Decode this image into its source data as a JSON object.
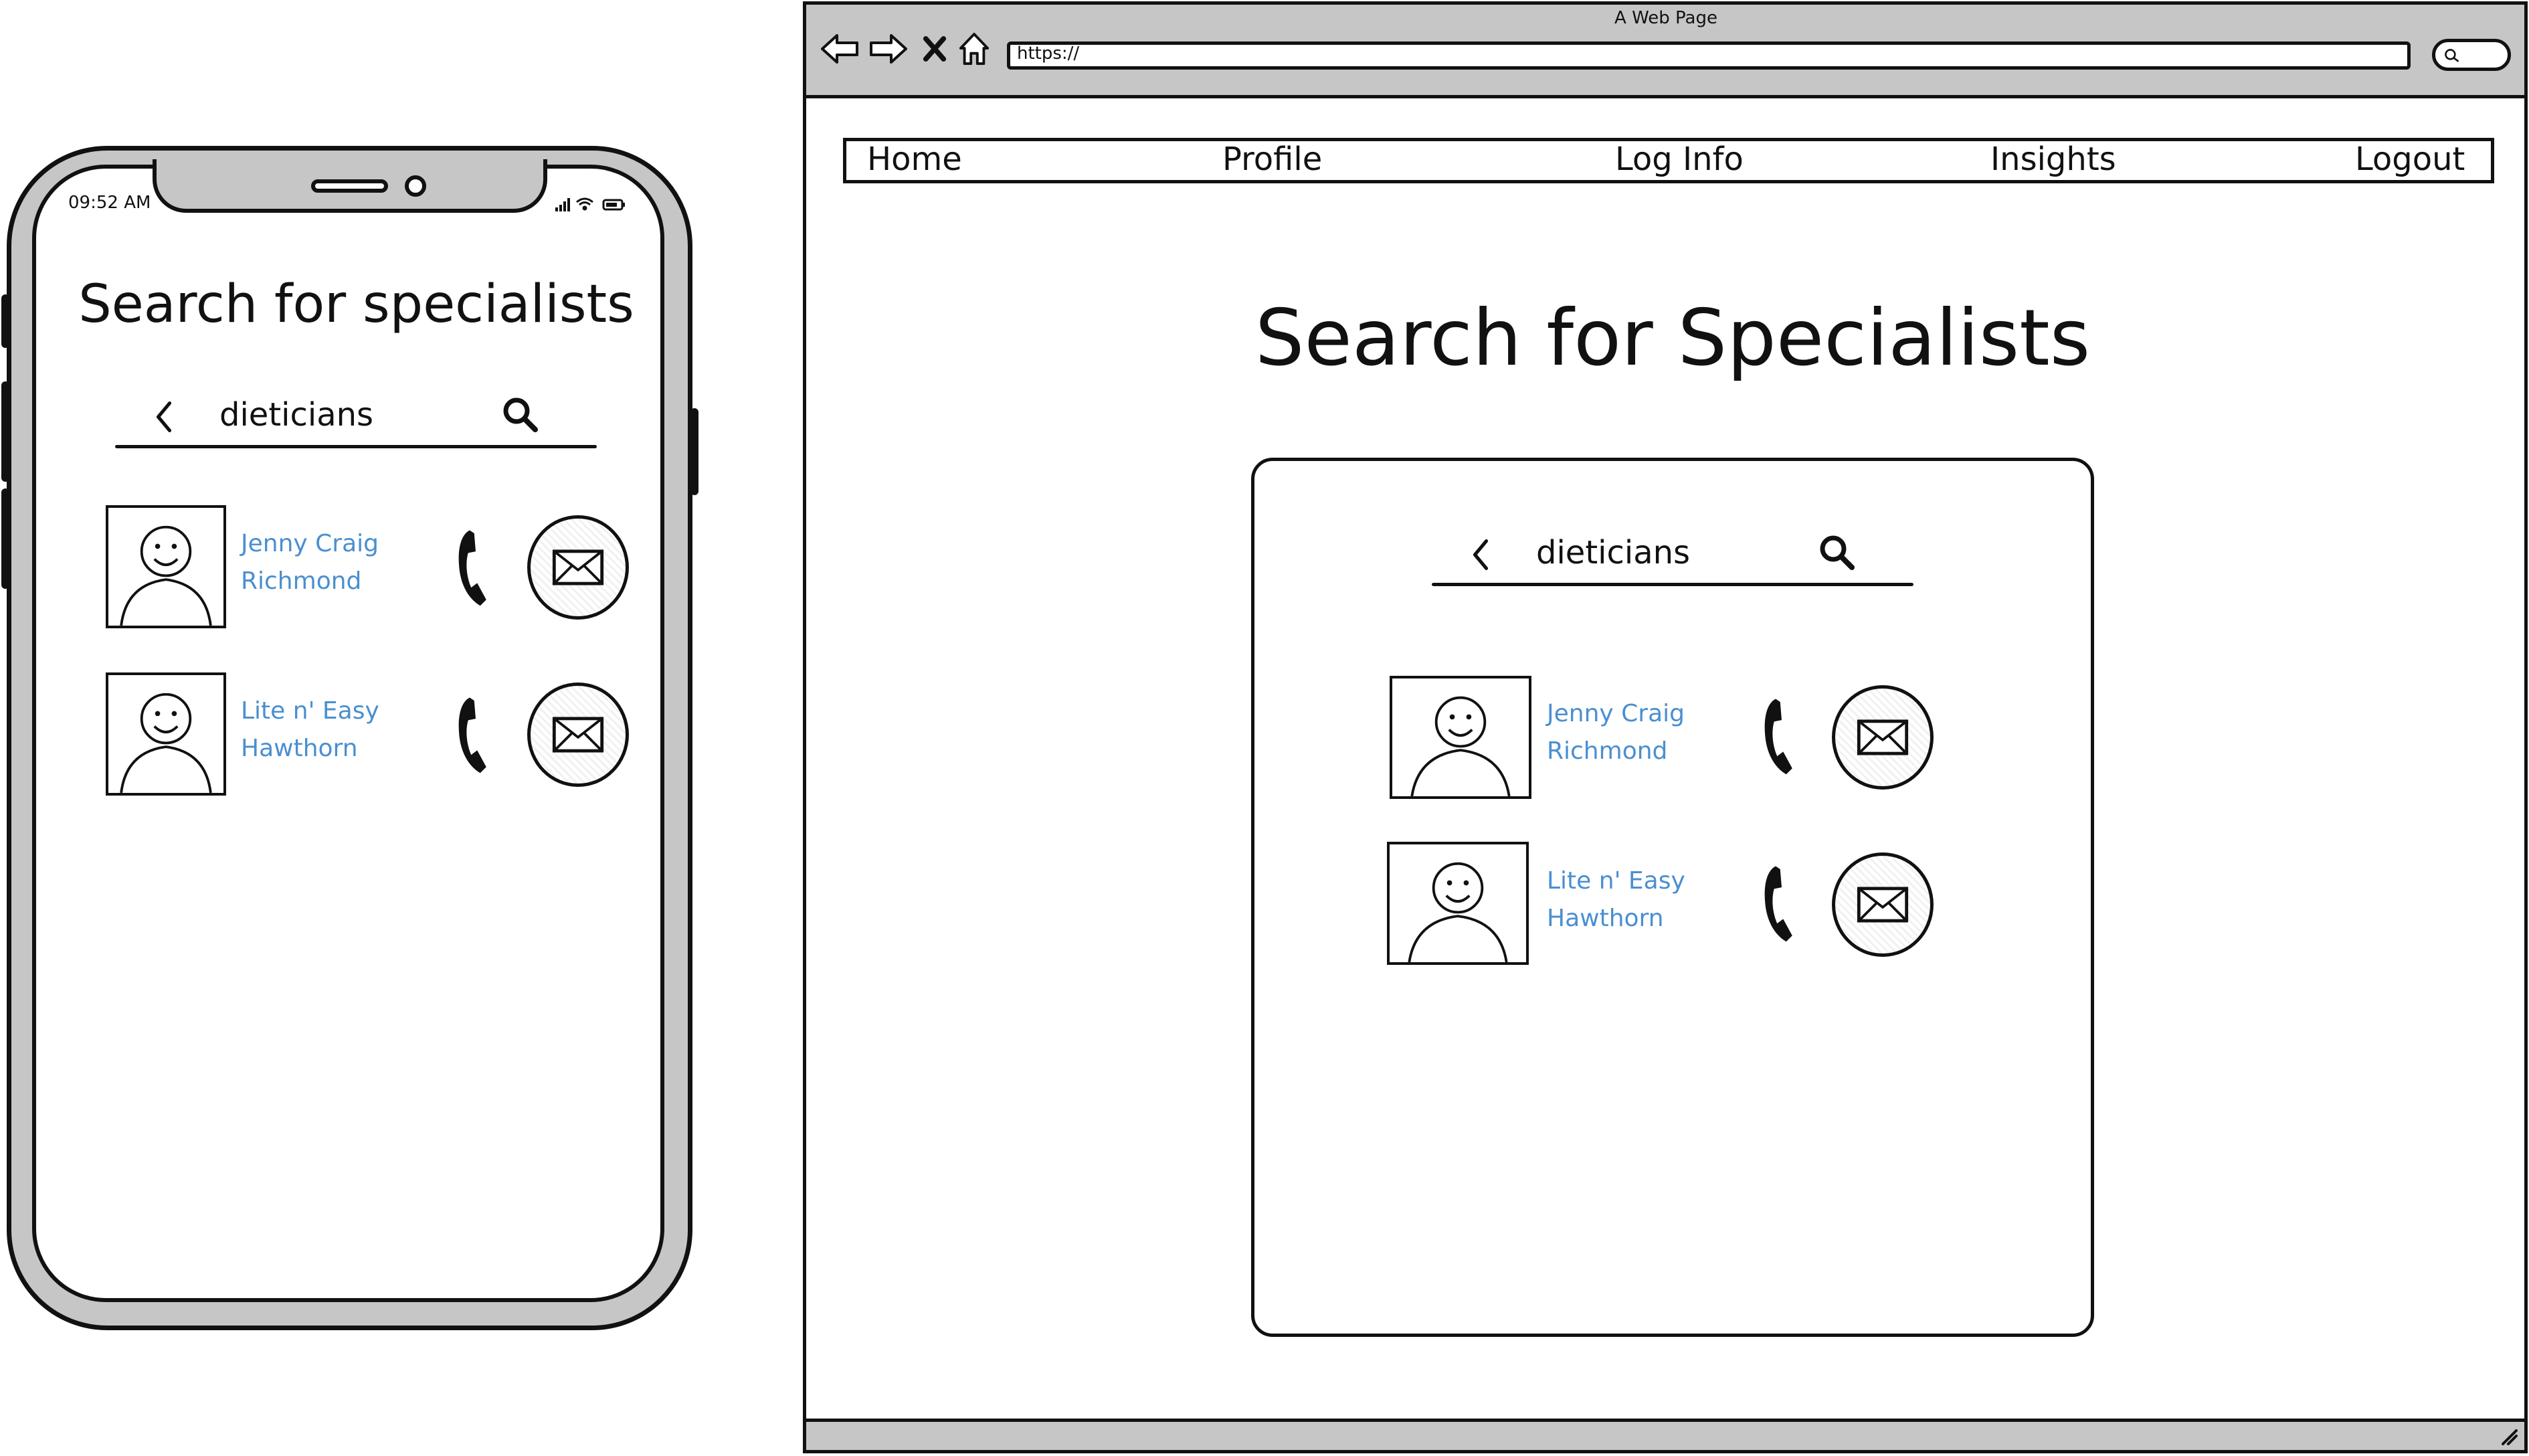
{
  "phone": {
    "time": "09:52 AM",
    "title": "Search for specialists",
    "search": {
      "query": "dieticians"
    },
    "results": [
      {
        "name": "Jenny Craig",
        "city": "Richmond"
      },
      {
        "name": "Lite n' Easy",
        "city": "Hawthorn"
      }
    ]
  },
  "browser": {
    "window_title": "A Web Page",
    "url": "https://",
    "nav": [
      {
        "label": "Home"
      },
      {
        "label": "Profile"
      },
      {
        "label": "Log Info"
      },
      {
        "label": "Insights"
      },
      {
        "label": "Logout"
      }
    ],
    "page_title": "Search for Specialists",
    "search": {
      "query": "dieticians"
    },
    "results": [
      {
        "name": "Jenny Craig",
        "city": "Richmond"
      },
      {
        "name": "Lite n' Easy",
        "city": "Hawthorn"
      }
    ]
  },
  "colors": {
    "link": "#4a8fd0",
    "chrome": "#c6c6c6",
    "ink": "#111111"
  },
  "icons": [
    "back-icon",
    "search-icon",
    "phone-icon",
    "mail-icon",
    "avatar-icon",
    "forward-icon",
    "close-icon",
    "home-icon",
    "signal-icon",
    "wifi-icon",
    "battery-icon"
  ]
}
